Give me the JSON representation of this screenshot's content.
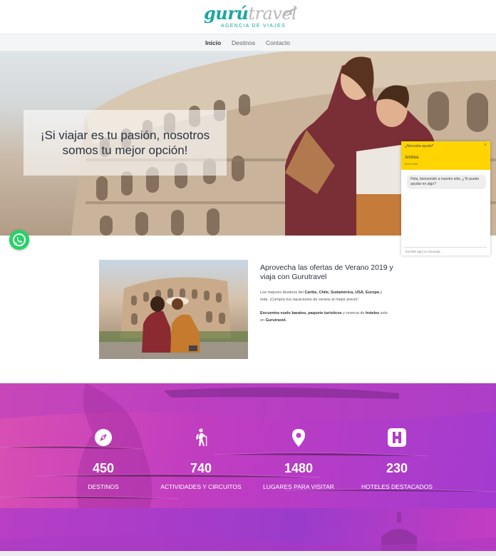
{
  "header": {
    "logo_main_1": "gurú",
    "logo_main_2": "travel",
    "logo_sub": "AGENCIA DE VIAJES",
    "brand_color": "#1aa6a0"
  },
  "nav": {
    "items": [
      {
        "label": "Inicio",
        "active": true
      },
      {
        "label": "Destinos",
        "active": false
      },
      {
        "label": "Contacto",
        "active": false
      }
    ]
  },
  "hero": {
    "title_line1": "¡Si viajar es tu pasión, nosotros",
    "title_line2": "somos tu mejor opción!"
  },
  "chat": {
    "question": "¿Necesita ayuda?",
    "close": "×",
    "agent_name": "Andrea",
    "status": "● En línea",
    "message": "Hola, bienvenido a nuestro sitio, ¿Te puedo ayudar en algo?",
    "input_placeholder": "Escribe aquí tu mensaje..."
  },
  "whatsapp": {
    "icon": "whatsapp-icon",
    "color": "#25d366"
  },
  "offer": {
    "title": "Aprovecha las ofertas de Verano 2019 y viaja con Gurutravel",
    "p1_prefix": "Los mejores destinos del ",
    "p1_bold1": "Caribe, Chile, Sudamérica, USA, Europa",
    "p1_suffix": " y más. ¡Compra tus vacaciones de verano al mejor precio!",
    "p2_bold1": "Encuentra vuelo baratos, paquete turísticos",
    "p2_mid": " y reserva de ",
    "p2_bold2": "hoteles",
    "p2_mid2": " solo en ",
    "p2_bold3": "Gurutravel."
  },
  "stats": {
    "accent": "#c13dc0",
    "items": [
      {
        "icon": "compass-icon",
        "value": "450",
        "label": "DESTINOS"
      },
      {
        "icon": "hiker-icon",
        "value": "740",
        "label": "ACTIVIDADES Y CIRCUITOS"
      },
      {
        "icon": "map-pin-icon",
        "value": "1480",
        "label": "LUGARES PARA VISITAR"
      },
      {
        "icon": "hotel-icon",
        "value": "230",
        "label": "HOTELES DESTACADOS"
      }
    ]
  }
}
